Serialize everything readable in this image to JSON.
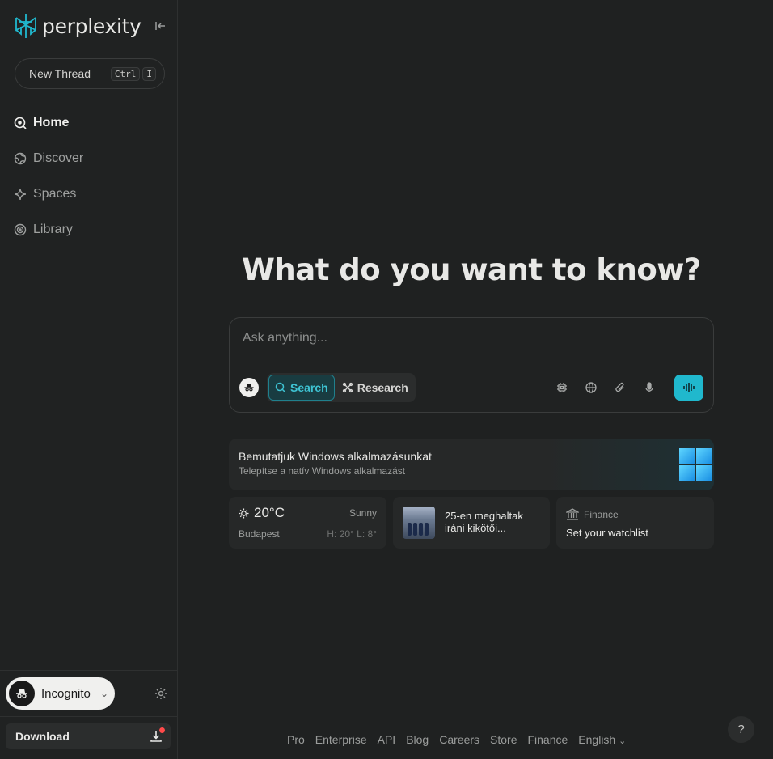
{
  "brand": {
    "name": "perplexity",
    "accent": "#20b8cd"
  },
  "sidebar": {
    "new_thread": {
      "label": "New Thread",
      "keys": [
        "Ctrl",
        "I"
      ]
    },
    "items": [
      {
        "label": "Home",
        "icon": "home-icon",
        "active": true
      },
      {
        "label": "Discover",
        "icon": "globe-icon",
        "active": false
      },
      {
        "label": "Spaces",
        "icon": "sparkle-icon",
        "active": false
      },
      {
        "label": "Library",
        "icon": "library-icon",
        "active": false
      }
    ],
    "account": {
      "name": "Incognito"
    },
    "download": {
      "label": "Download"
    }
  },
  "main": {
    "title": "What do you want to know?",
    "search": {
      "placeholder": "Ask anything...",
      "modes": [
        {
          "label": "Search",
          "active": true
        },
        {
          "label": "Research",
          "active": false
        }
      ],
      "tools": [
        "model-icon",
        "globe-icon",
        "attach-icon",
        "mic-icon"
      ]
    },
    "banner": {
      "title": "Bemutatjuk Windows alkalmazásunkat",
      "subtitle": "Telepítse a natív Windows alkalmazást"
    },
    "weather": {
      "temp": "20°C",
      "condition": "Sunny",
      "city": "Budapest",
      "hilo": "H: 20° L: 8°"
    },
    "news": {
      "text": "25-en meghaltak iráni kikötői..."
    },
    "finance": {
      "label": "Finance",
      "text": "Set your watchlist"
    }
  },
  "footer": {
    "links": [
      "Pro",
      "Enterprise",
      "API",
      "Blog",
      "Careers",
      "Store",
      "Finance",
      "English"
    ],
    "help": "?"
  }
}
